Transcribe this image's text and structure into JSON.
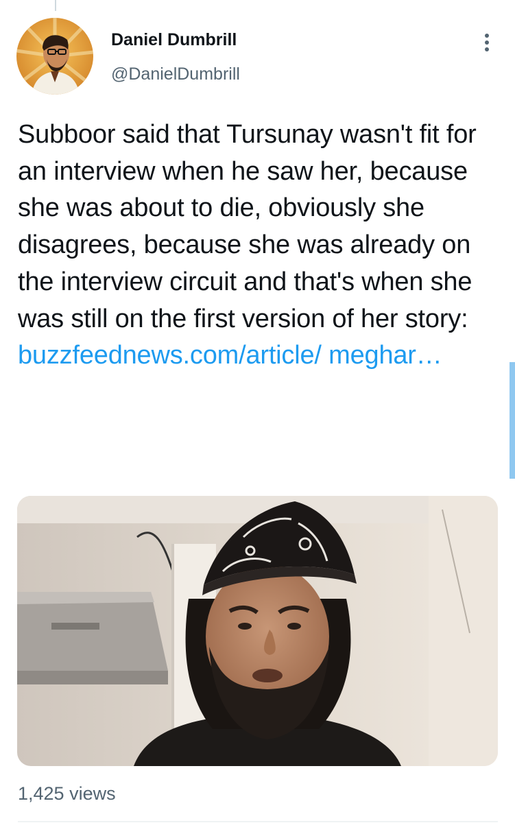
{
  "tweet": {
    "author": {
      "name": "Daniel Dumbrill",
      "handle": "@DanielDumbrill"
    },
    "text": "Subboor said that Tursunay wasn't fit for an interview when he saw her, because she was about to die, obviously she disagrees, because she was already on the interview circuit and that's when she was still on the first version of her story: ",
    "link_text": "buzzfeednews.com/article/ meghar…",
    "views": "1,425 views"
  },
  "icons": {
    "more": "more-vertical-icon",
    "avatar": "avatar-illustration",
    "media": "video-thumbnail"
  },
  "colors": {
    "link": "#1d9bf0",
    "secondary_text": "#536471",
    "primary_text": "#0f1419"
  }
}
